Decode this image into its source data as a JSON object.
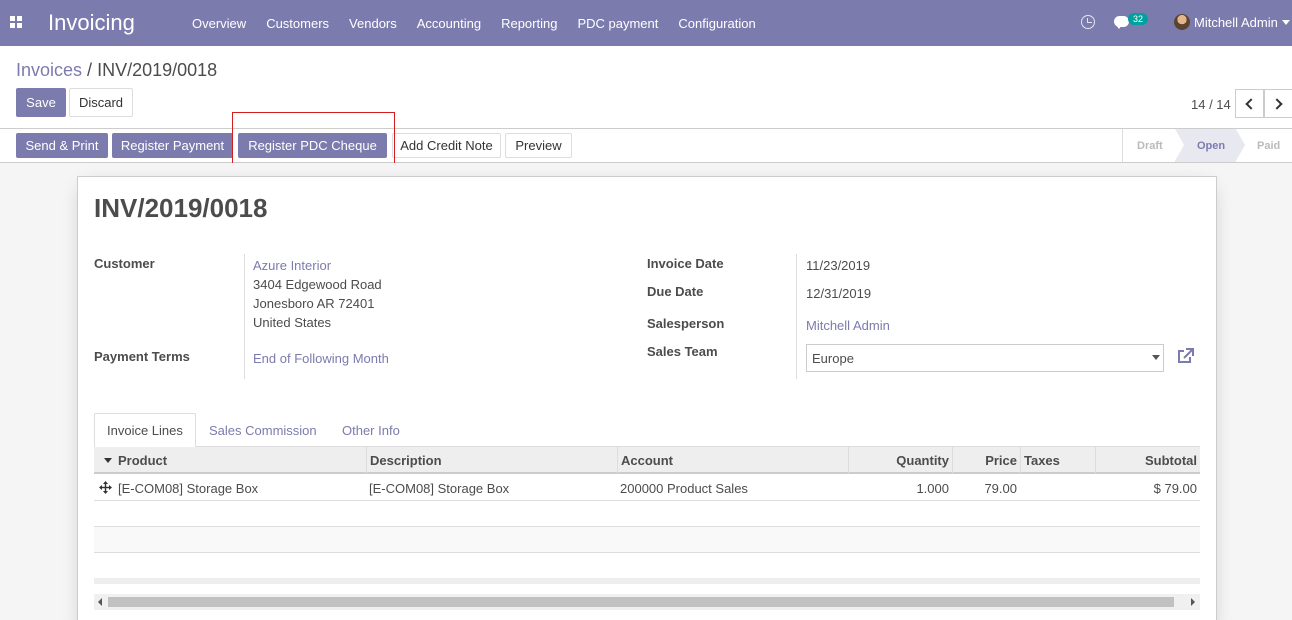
{
  "app": {
    "title": "Invoicing",
    "menu": [
      "Overview",
      "Customers",
      "Vendors",
      "Accounting",
      "Reporting",
      "PDC payment",
      "Configuration"
    ],
    "chat_count": "32",
    "user_name": "Mitchell Admin"
  },
  "breadcrumb": {
    "parent": "Invoices",
    "separator": " / ",
    "current": "INV/2019/0018"
  },
  "form_buttons": {
    "save": "Save",
    "discard": "Discard"
  },
  "pager": {
    "value": "14 / 14"
  },
  "statusbar": {
    "buttons": [
      "Send & Print",
      "Register Payment",
      "Register PDC Cheque",
      "Add Credit Note",
      "Preview"
    ],
    "stages": [
      "Draft",
      "Open",
      "Paid"
    ],
    "active_stage": "Open"
  },
  "invoice": {
    "number": "INV/2019/0018",
    "customer_label": "Customer",
    "customer_name": "Azure Interior",
    "address": [
      "3404 Edgewood Road",
      "Jonesboro AR 72401",
      "United States"
    ],
    "payment_terms_label": "Payment Terms",
    "payment_terms": "End of Following Month",
    "invoice_date_label": "Invoice Date",
    "invoice_date": "11/23/2019",
    "due_date_label": "Due Date",
    "due_date": "12/31/2019",
    "salesperson_label": "Salesperson",
    "salesperson": "Mitchell Admin",
    "sales_team_label": "Sales Team",
    "sales_team": "Europe"
  },
  "tabs": [
    "Invoice Lines",
    "Sales Commission",
    "Other Info"
  ],
  "lines": {
    "columns": [
      "Product",
      "Description",
      "Account",
      "Quantity",
      "Price",
      "Taxes",
      "Subtotal"
    ],
    "rows": [
      {
        "product": "[E-COM08] Storage Box",
        "description": "[E-COM08] Storage Box",
        "account": "200000 Product Sales",
        "quantity": "1.000",
        "price": "79.00",
        "taxes": "",
        "subtotal": "$ 79.00"
      }
    ]
  },
  "colors": {
    "brand": "#7c7bad",
    "highlight": "#d41d1d",
    "teal_badge": "#00a09d"
  }
}
